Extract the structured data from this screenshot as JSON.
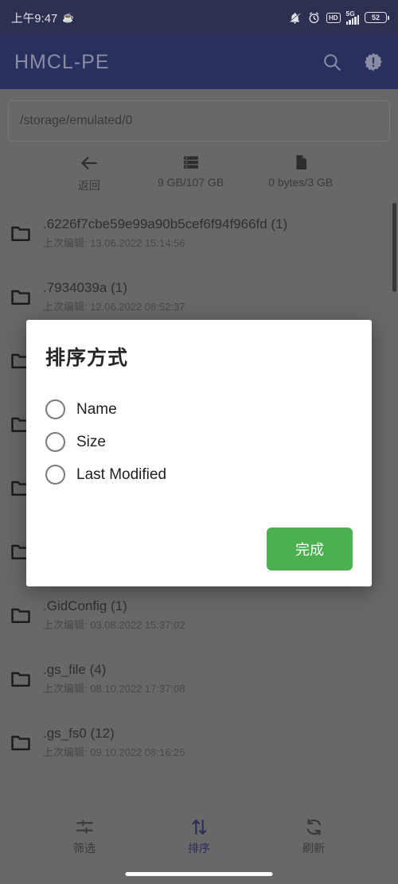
{
  "status_bar": {
    "time": "上午9:47",
    "emoji": "☕",
    "icons": [
      "bell-muted-icon",
      "alarm-clock-icon",
      "hd-icon",
      "signal-5g-icon",
      "battery-icon"
    ],
    "network_label": "5G",
    "hd_label": "HD",
    "battery_level": "52",
    "background_color": "#2e3152"
  },
  "app_bar": {
    "title": "HMCL-PE",
    "background_color": "#2b3160",
    "title_color": "#8b8fa8",
    "search_icon": "search-icon",
    "alert_icon": "alert-badge-icon"
  },
  "path_bar": {
    "value": "/storage/emulated/0",
    "placeholder": "/storage/emulated/0"
  },
  "quick_bar": {
    "items": [
      {
        "label": "返回",
        "icon": "back-arrow-icon",
        "value": ""
      },
      {
        "label": "9 GB/107 GB",
        "icon": "internal-storage-icon",
        "value": "9 GB/107 GB"
      },
      {
        "label": "0 bytes/3 GB",
        "icon": "sd-card-icon",
        "value": "0 bytes/3 GB"
      }
    ]
  },
  "file_list": {
    "meta_prefix": "上次编辑: ",
    "items": [
      {
        "name": ".6226f7cbe59e99a90b5cef6f94f966fd (1)",
        "meta": "上次编辑: 13.06.2022 15:14:56"
      },
      {
        "name": ".7934039a (1)",
        "meta": "上次编辑: 12.06.2022 08:52:37"
      },
      {
        "name": "",
        "meta": ""
      },
      {
        "name": "",
        "meta": ""
      },
      {
        "name": "",
        "meta": ""
      },
      {
        "name": "",
        "meta": ""
      },
      {
        "name": ".GidConfig (1)",
        "meta": "上次编辑: 03.08.2022 15:37:02"
      },
      {
        "name": ".gs_file (4)",
        "meta": "上次编辑: 08.10.2022 17:37:08"
      },
      {
        "name": ".gs_fs0 (12)",
        "meta": "上次编辑: 09.10.2022 08:16:25"
      }
    ]
  },
  "dialog": {
    "title": "排序方式",
    "options": [
      {
        "label": "Name",
        "selected": false
      },
      {
        "label": "Size",
        "selected": false
      },
      {
        "label": "Last Modified",
        "selected": false
      }
    ],
    "confirm_label": "完成",
    "confirm_color": "#4CAF50"
  },
  "bottom_nav": {
    "items": [
      {
        "label": "筛选",
        "icon": "filter-icon",
        "active": false
      },
      {
        "label": "排序",
        "icon": "sort-icon",
        "active": true
      },
      {
        "label": "刷新",
        "icon": "refresh-icon",
        "active": false
      }
    ],
    "active_color": "#2b3160"
  }
}
